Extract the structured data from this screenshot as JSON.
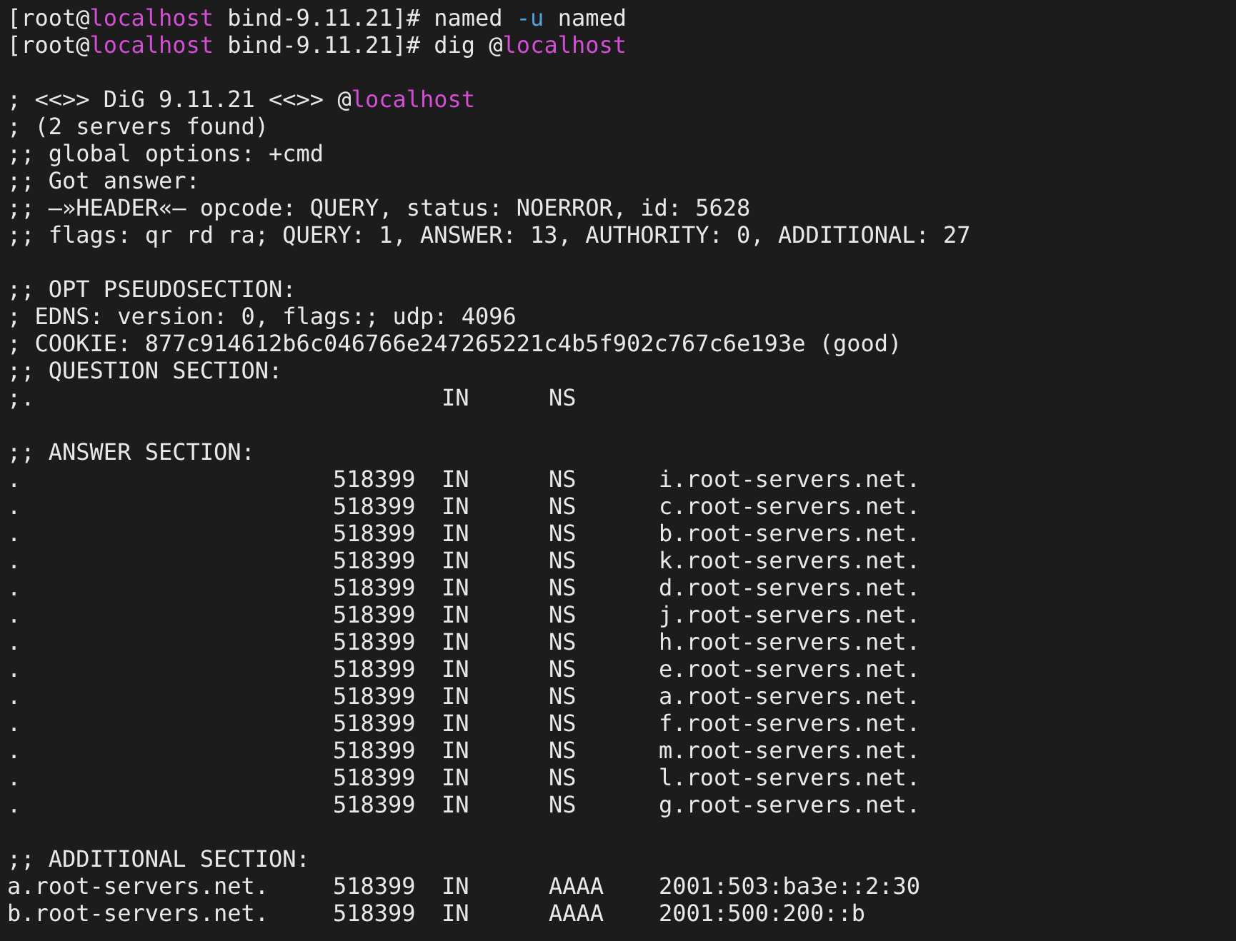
{
  "terminal": {
    "lines": [
      {
        "kind": "text",
        "segments": [
          {
            "kind": "plain",
            "text": "[root@"
          },
          {
            "kind": "host",
            "text": "localhost"
          },
          {
            "kind": "plain",
            "text": " bind-9.11.21]# named "
          },
          {
            "kind": "option",
            "text": "-u"
          },
          {
            "kind": "plain",
            "text": " named"
          }
        ]
      },
      {
        "kind": "text",
        "segments": [
          {
            "kind": "plain",
            "text": "[root@"
          },
          {
            "kind": "host",
            "text": "localhost"
          },
          {
            "kind": "plain",
            "text": " bind-9.11.21]# dig @"
          },
          {
            "kind": "host",
            "text": "localhost"
          }
        ]
      },
      {
        "kind": "blank"
      },
      {
        "kind": "text",
        "segments": [
          {
            "kind": "plain",
            "text": "; <<>> DiG 9.11.21 <<>> @"
          },
          {
            "kind": "host",
            "text": "localhost"
          }
        ]
      },
      {
        "kind": "text",
        "segments": [
          {
            "kind": "plain",
            "text": "; (2 servers found)"
          }
        ]
      },
      {
        "kind": "text",
        "segments": [
          {
            "kind": "plain",
            "text": ";; global options: +cmd"
          }
        ]
      },
      {
        "kind": "text",
        "segments": [
          {
            "kind": "plain",
            "text": ";; Got answer:"
          }
        ]
      },
      {
        "kind": "text",
        "segments": [
          {
            "kind": "plain",
            "text": ";; —»HEADER«— opcode: QUERY, status: NOERROR, id: 5628"
          }
        ]
      },
      {
        "kind": "text",
        "segments": [
          {
            "kind": "plain",
            "text": ";; flags: qr rd ra; QUERY: 1, ANSWER: 13, AUTHORITY: 0, ADDITIONAL: 27"
          }
        ]
      },
      {
        "kind": "blank"
      },
      {
        "kind": "text",
        "segments": [
          {
            "kind": "plain",
            "text": ";; OPT PSEUDOSECTION:"
          }
        ]
      },
      {
        "kind": "text",
        "segments": [
          {
            "kind": "plain",
            "text": "; EDNS: version: 0, flags:; udp: 4096"
          }
        ]
      },
      {
        "kind": "text",
        "segments": [
          {
            "kind": "plain",
            "text": "; COOKIE: 877c914612b6c046766e247265221c4b5f902c767c6e193e (good)"
          }
        ]
      },
      {
        "kind": "text",
        "segments": [
          {
            "kind": "plain",
            "text": ";; QUESTION SECTION:"
          }
        ]
      },
      {
        "kind": "record",
        "name": ";.",
        "class": "IN",
        "type": "NS"
      },
      {
        "kind": "blank"
      },
      {
        "kind": "text",
        "segments": [
          {
            "kind": "plain",
            "text": ";; ANSWER SECTION:"
          }
        ]
      },
      {
        "kind": "record",
        "name": ".",
        "ttl": "518399",
        "class": "IN",
        "type": "NS",
        "data": "i.root-servers.net."
      },
      {
        "kind": "record",
        "name": ".",
        "ttl": "518399",
        "class": "IN",
        "type": "NS",
        "data": "c.root-servers.net."
      },
      {
        "kind": "record",
        "name": ".",
        "ttl": "518399",
        "class": "IN",
        "type": "NS",
        "data": "b.root-servers.net."
      },
      {
        "kind": "record",
        "name": ".",
        "ttl": "518399",
        "class": "IN",
        "type": "NS",
        "data": "k.root-servers.net."
      },
      {
        "kind": "record",
        "name": ".",
        "ttl": "518399",
        "class": "IN",
        "type": "NS",
        "data": "d.root-servers.net."
      },
      {
        "kind": "record",
        "name": ".",
        "ttl": "518399",
        "class": "IN",
        "type": "NS",
        "data": "j.root-servers.net."
      },
      {
        "kind": "record",
        "name": ".",
        "ttl": "518399",
        "class": "IN",
        "type": "NS",
        "data": "h.root-servers.net."
      },
      {
        "kind": "record",
        "name": ".",
        "ttl": "518399",
        "class": "IN",
        "type": "NS",
        "data": "e.root-servers.net."
      },
      {
        "kind": "record",
        "name": ".",
        "ttl": "518399",
        "class": "IN",
        "type": "NS",
        "data": "a.root-servers.net."
      },
      {
        "kind": "record",
        "name": ".",
        "ttl": "518399",
        "class": "IN",
        "type": "NS",
        "data": "f.root-servers.net."
      },
      {
        "kind": "record",
        "name": ".",
        "ttl": "518399",
        "class": "IN",
        "type": "NS",
        "data": "m.root-servers.net."
      },
      {
        "kind": "record",
        "name": ".",
        "ttl": "518399",
        "class": "IN",
        "type": "NS",
        "data": "l.root-servers.net."
      },
      {
        "kind": "record",
        "name": ".",
        "ttl": "518399",
        "class": "IN",
        "type": "NS",
        "data": "g.root-servers.net."
      },
      {
        "kind": "blank"
      },
      {
        "kind": "text",
        "segments": [
          {
            "kind": "plain",
            "text": ";; ADDITIONAL SECTION:"
          }
        ]
      },
      {
        "kind": "record",
        "name": "a.root-servers.net.",
        "ttl": "518399",
        "class": "IN",
        "type": "AAAA",
        "data": "2001:503:ba3e::2:30"
      },
      {
        "kind": "record",
        "name": "b.root-servers.net.",
        "ttl": "518399",
        "class": "IN",
        "type": "AAAA",
        "data": "2001:500:200::b"
      }
    ]
  }
}
